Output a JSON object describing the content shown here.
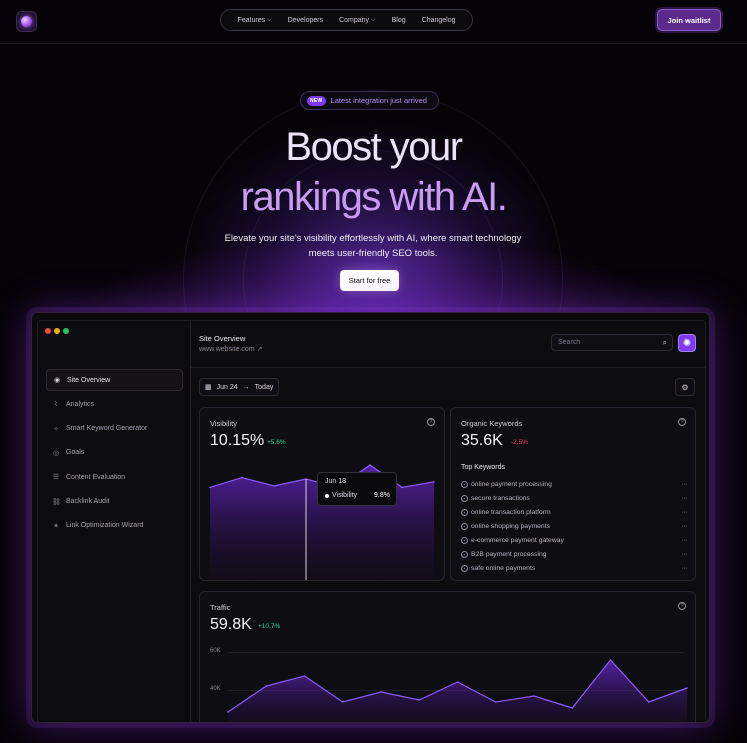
{
  "nav": {
    "items": [
      {
        "label": "Features",
        "dropdown": true
      },
      {
        "label": "Developers",
        "dropdown": false
      },
      {
        "label": "Company",
        "dropdown": true
      },
      {
        "label": "Blog",
        "dropdown": false
      },
      {
        "label": "Changelog",
        "dropdown": false
      }
    ],
    "join_label": "Join waitlist",
    "chevron": "⌵"
  },
  "hero": {
    "badge_tag": "NEW",
    "badge_text": "Latest integration just arrived",
    "title_line1": "Boost your",
    "title_line2": "rankings with AI.",
    "subtitle": "Elevate your site's visibility effortlessly with AI, where smart technology meets user-friendly SEO tools.",
    "cta_label": "Start for free"
  },
  "colors": {
    "accent": "#7e3af2",
    "accent_light": "#c79df0",
    "positive": "#34d399",
    "negative": "#f43f5e",
    "window_dots": [
      "#ef4444",
      "#eab308",
      "#22c55e"
    ]
  },
  "sidebar": {
    "items": [
      {
        "label": "Site Overview",
        "icon": "eye-icon",
        "glyph": "◉",
        "active": true
      },
      {
        "label": "Analytics",
        "icon": "chart-icon",
        "glyph": "⌇",
        "active": false
      },
      {
        "label": "Smart Keyword Generator",
        "icon": "sparkle-icon",
        "glyph": "✧",
        "active": false
      },
      {
        "label": "Goals",
        "icon": "target-icon",
        "glyph": "◎",
        "active": false
      },
      {
        "label": "Content Evaluation",
        "icon": "list-icon",
        "glyph": "☰",
        "active": false
      },
      {
        "label": "Backlink Audit",
        "icon": "link-icon",
        "glyph": "⛓",
        "active": false
      },
      {
        "label": "Link Optimization Wizard",
        "icon": "wand-icon",
        "glyph": "✶",
        "active": false
      }
    ]
  },
  "overview": {
    "title": "Site Overview",
    "url": "www.website.com",
    "url_arrow": "↗",
    "search_placeholder": "Search",
    "search_glyph": "⌕",
    "ai_glyph": "✺",
    "date_from": "Jun 24",
    "date_arrow": "→",
    "date_to": "Today",
    "calendar_glyph": "▦",
    "settings_glyph": "⚙"
  },
  "visibility": {
    "title": "Visibility",
    "value": "10.15%",
    "delta": "+5.6%",
    "tooltip_date": "Jun 18",
    "tooltip_label": "Visibility",
    "tooltip_value": "9.8%"
  },
  "keywords": {
    "title": "Organic Keywords",
    "value": "35.6K",
    "delta": "-2.5%",
    "list_title": "Top Keywords",
    "items": [
      "online payment processing",
      "secure transactions",
      "online transaction platform",
      "online shopping payments",
      "e-commerce payment gateway",
      "B2B payment processing",
      "safe online payments"
    ],
    "more": "···"
  },
  "traffic": {
    "title": "Traffic",
    "value": "59.8K",
    "delta": "+10.7%",
    "ticks": [
      "60K",
      "40K"
    ]
  },
  "chart_data": [
    {
      "type": "area",
      "title": "Visibility",
      "ylim": [
        0,
        1
      ],
      "values": [
        0.58,
        0.72,
        0.6,
        0.7,
        0.58,
        0.9,
        0.58,
        0.66
      ]
    },
    {
      "type": "area",
      "title": "Traffic",
      "ytick_labels": [
        "60K",
        "40K"
      ],
      "ylim": [
        20,
        70
      ],
      "values": [
        30,
        43,
        48,
        35,
        40,
        36,
        45,
        35,
        38,
        32,
        56,
        35,
        42
      ]
    }
  ]
}
